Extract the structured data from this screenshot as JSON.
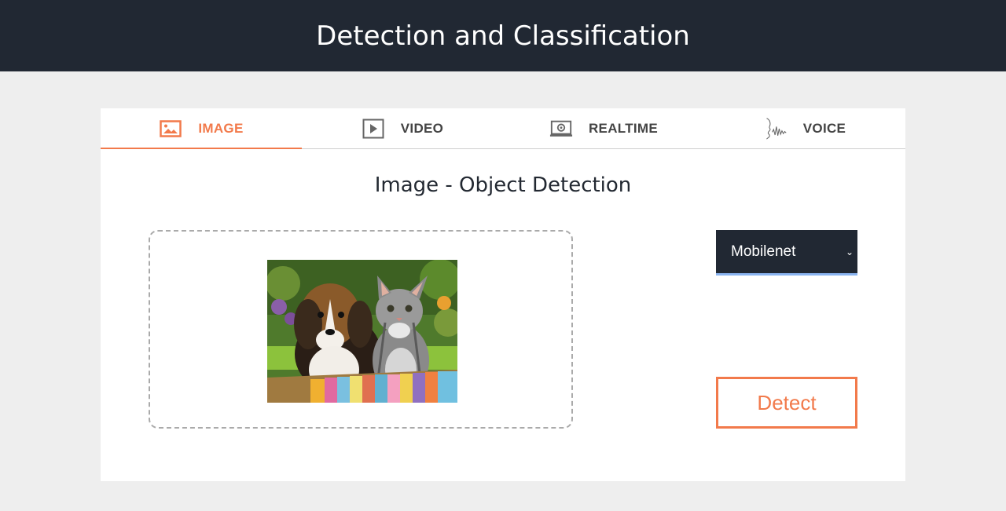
{
  "header": {
    "title": "Detection and Classification"
  },
  "tabs": [
    {
      "label": "IMAGE",
      "icon": "image-icon",
      "active": true
    },
    {
      "label": "VIDEO",
      "icon": "play-icon",
      "active": false
    },
    {
      "label": "REALTIME",
      "icon": "webcam-icon",
      "active": false
    },
    {
      "label": "VOICE",
      "icon": "voice-wave-icon",
      "active": false
    }
  ],
  "main": {
    "section_title": "Image - Object Detection",
    "model_select": {
      "selected": "Mobilenet"
    },
    "detect_label": "Detect"
  },
  "colors": {
    "header_bg": "#212833",
    "accent": "#f27a4b",
    "page_bg": "#eeeeee",
    "select_underline": "#8ab4f0"
  }
}
